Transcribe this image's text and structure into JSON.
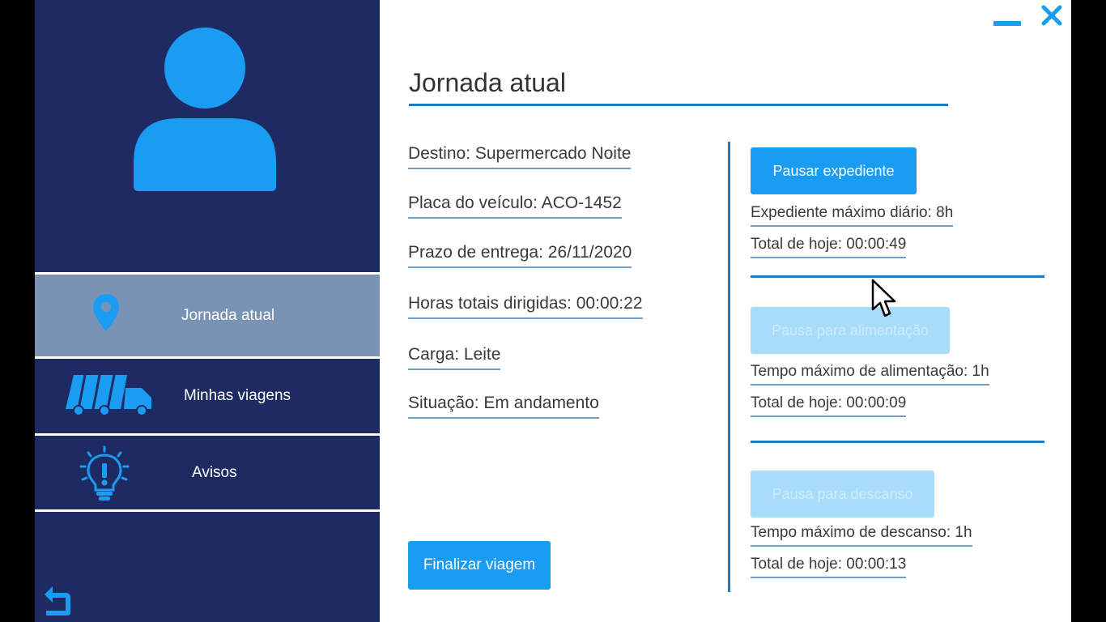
{
  "colors": {
    "sidebar_bg": "#1e2b63",
    "accent": "#1a9cf2",
    "active_nav_bg": "#7a93b4",
    "disabled_button_bg": "#a8dcfb"
  },
  "sidebar": {
    "avatar_icon": "user-avatar-icon",
    "items": [
      {
        "label": "Jornada atual",
        "icon": "location-pin-icon",
        "active": true
      },
      {
        "label": "Minhas viagens",
        "icon": "truck-icon",
        "active": false
      },
      {
        "label": "Avisos",
        "icon": "lightbulb-alert-icon",
        "active": false
      }
    ],
    "back_icon": "return-arrow-icon"
  },
  "window_controls": {
    "minimize_icon": "minimize-icon",
    "close_icon": "close-icon"
  },
  "main": {
    "title": "Jornada atual",
    "details": [
      "Destino: Supermercado Noite",
      "Placa do veículo: ACO-1452",
      "Prazo de entrega: 26/11/2020",
      "Horas totais dirigidas: 00:00:22",
      "Carga: Leite",
      "Situação: Em andamento"
    ],
    "finish_button": "Finalizar viagem"
  },
  "breaks": {
    "work": {
      "button": "Pausar expediente",
      "max_label": "Expediente máximo diário: 8h",
      "total_label": "Total de hoje: 00:00:49"
    },
    "meal": {
      "button": "Pausa para alimentação",
      "max_label": "Tempo máximo de alimentação: 1h",
      "total_label": "Total de hoje: 00:00:09"
    },
    "rest": {
      "button": "Pausa para descanso",
      "max_label": "Tempo máximo de descanso: 1h",
      "total_label": "Total de hoje: 00:00:13"
    }
  }
}
